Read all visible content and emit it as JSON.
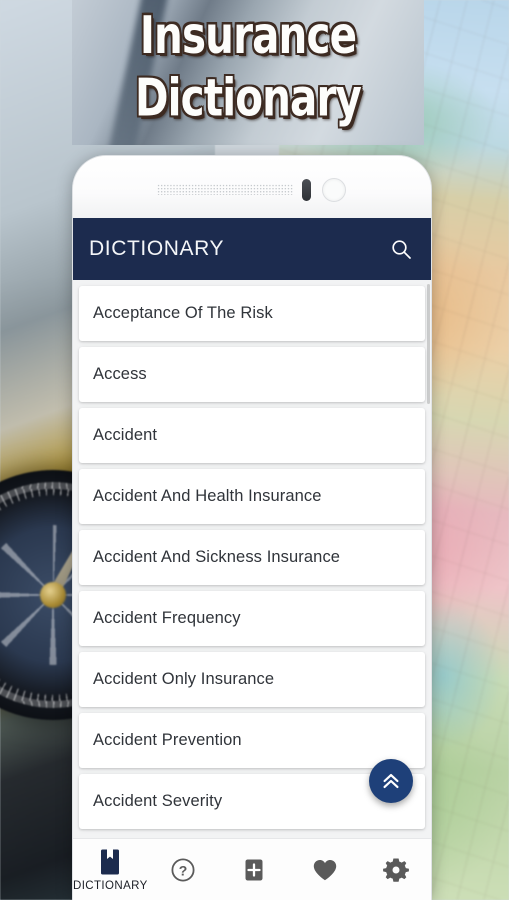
{
  "banner": {
    "title_line1": "Insurance",
    "title_line2": "Dictionary"
  },
  "app": {
    "appbar": {
      "title": "DICTIONARY",
      "search_icon": "search-icon"
    },
    "list": {
      "items": [
        {
          "label": "Acceptance Of The Risk"
        },
        {
          "label": "Access"
        },
        {
          "label": "Accident"
        },
        {
          "label": "Accident And Health Insurance"
        },
        {
          "label": "Accident And Sickness Insurance"
        },
        {
          "label": "Accident Frequency"
        },
        {
          "label": "Accident Only Insurance"
        },
        {
          "label": "Accident Prevention"
        },
        {
          "label": "Accident Severity"
        }
      ]
    },
    "fab": {
      "icon": "double-chevron-up-icon",
      "action": "scroll-to-top"
    },
    "bottom_nav": {
      "items": [
        {
          "icon": "book-bookmark-icon",
          "label": "DICTIONARY",
          "active": true
        },
        {
          "icon": "question-circle-icon",
          "label": "",
          "active": false
        },
        {
          "icon": "plus-square-icon",
          "label": "",
          "active": false
        },
        {
          "icon": "heart-icon",
          "label": "",
          "active": false
        },
        {
          "icon": "gear-icon",
          "label": "",
          "active": false
        }
      ]
    }
  },
  "colors": {
    "appbar": "#1C2B4E",
    "fab": "#1E4079",
    "nav_active": "#1C2B4E",
    "nav_inactive": "#5A5A5A",
    "card": "#FFFFFF",
    "card_text": "#30343A",
    "screen_bg": "#F2F3F4"
  }
}
